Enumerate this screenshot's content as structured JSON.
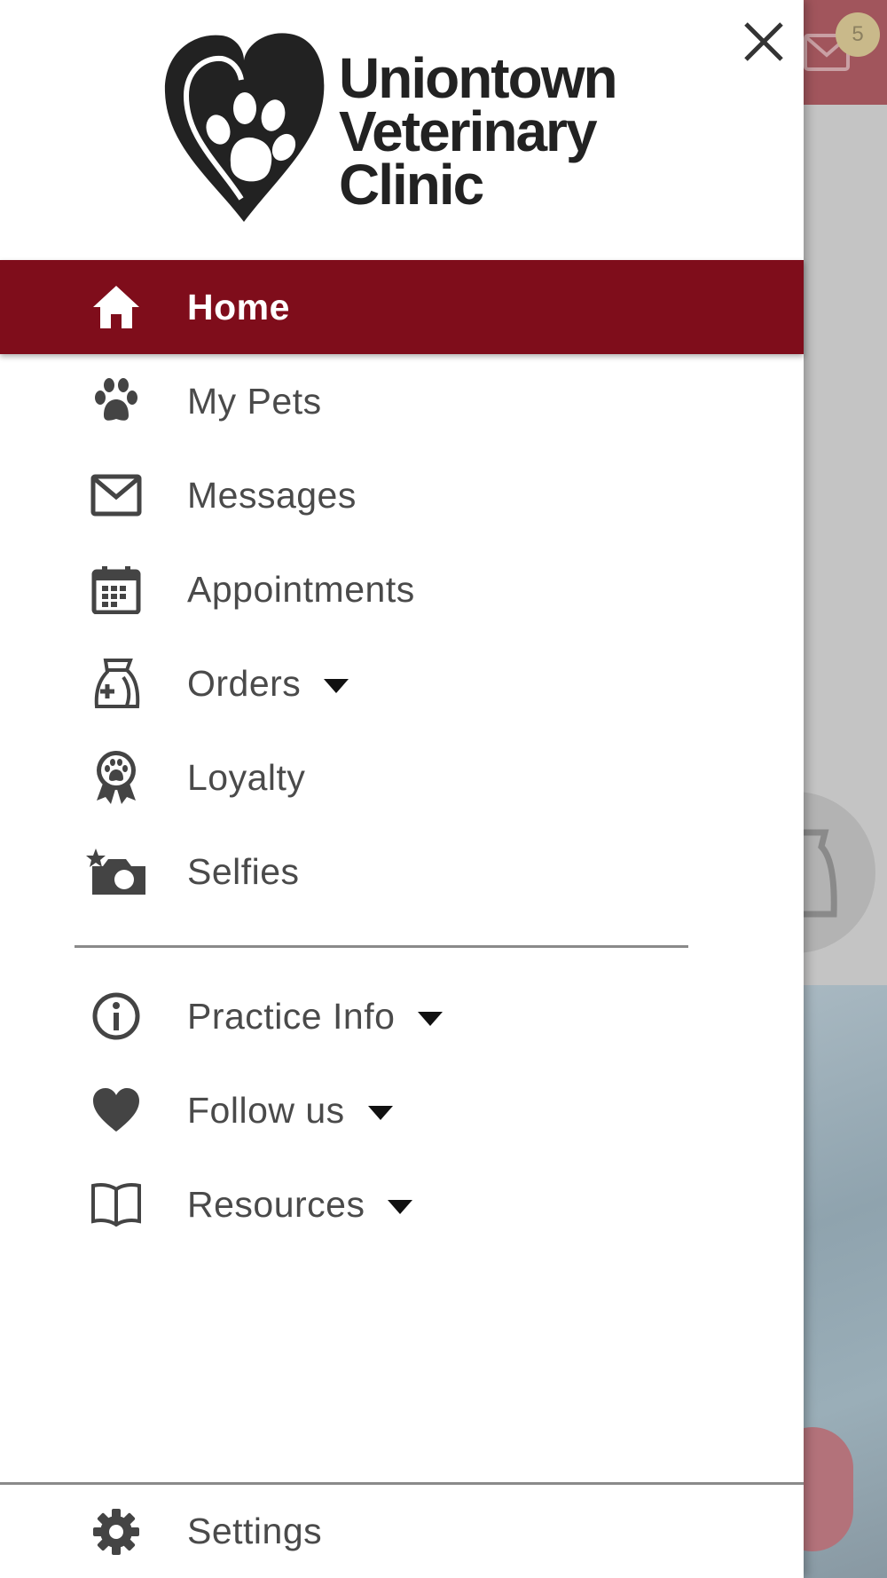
{
  "background": {
    "header_color": "#a1555c",
    "badge_count": "5",
    "icons": [
      "envelope-icon",
      "food-bag-icon"
    ]
  },
  "drawer": {
    "close_icon": "close-icon",
    "logo": {
      "line1": "Uniontown",
      "line2": "Veterinary",
      "line3": "Clinic",
      "emblem": "heart-paw-icon"
    },
    "primary_items": [
      {
        "label": "Home",
        "icon": "home-icon",
        "active": true,
        "has_dropdown": false
      },
      {
        "label": "My Pets",
        "icon": "paw-icon",
        "active": false,
        "has_dropdown": false
      },
      {
        "label": "Messages",
        "icon": "envelope-icon",
        "active": false,
        "has_dropdown": false
      },
      {
        "label": "Appointments",
        "icon": "calendar-icon",
        "active": false,
        "has_dropdown": false
      },
      {
        "label": "Orders",
        "icon": "medicine-bag-icon",
        "active": false,
        "has_dropdown": true
      },
      {
        "label": "Loyalty",
        "icon": "award-ribbon-icon",
        "active": false,
        "has_dropdown": false
      },
      {
        "label": "Selfies",
        "icon": "camera-icon",
        "active": false,
        "has_dropdown": false
      }
    ],
    "secondary_items": [
      {
        "label": "Practice Info",
        "icon": "info-icon",
        "has_dropdown": true
      },
      {
        "label": "Follow us",
        "icon": "heart-icon",
        "has_dropdown": true
      },
      {
        "label": "Resources",
        "icon": "book-icon",
        "has_dropdown": true
      }
    ],
    "settings": {
      "label": "Settings",
      "icon": "gear-icon"
    },
    "colors": {
      "active_bg": "#7f0d1b",
      "text": "#4a4a4a",
      "icon": "#444444"
    }
  }
}
